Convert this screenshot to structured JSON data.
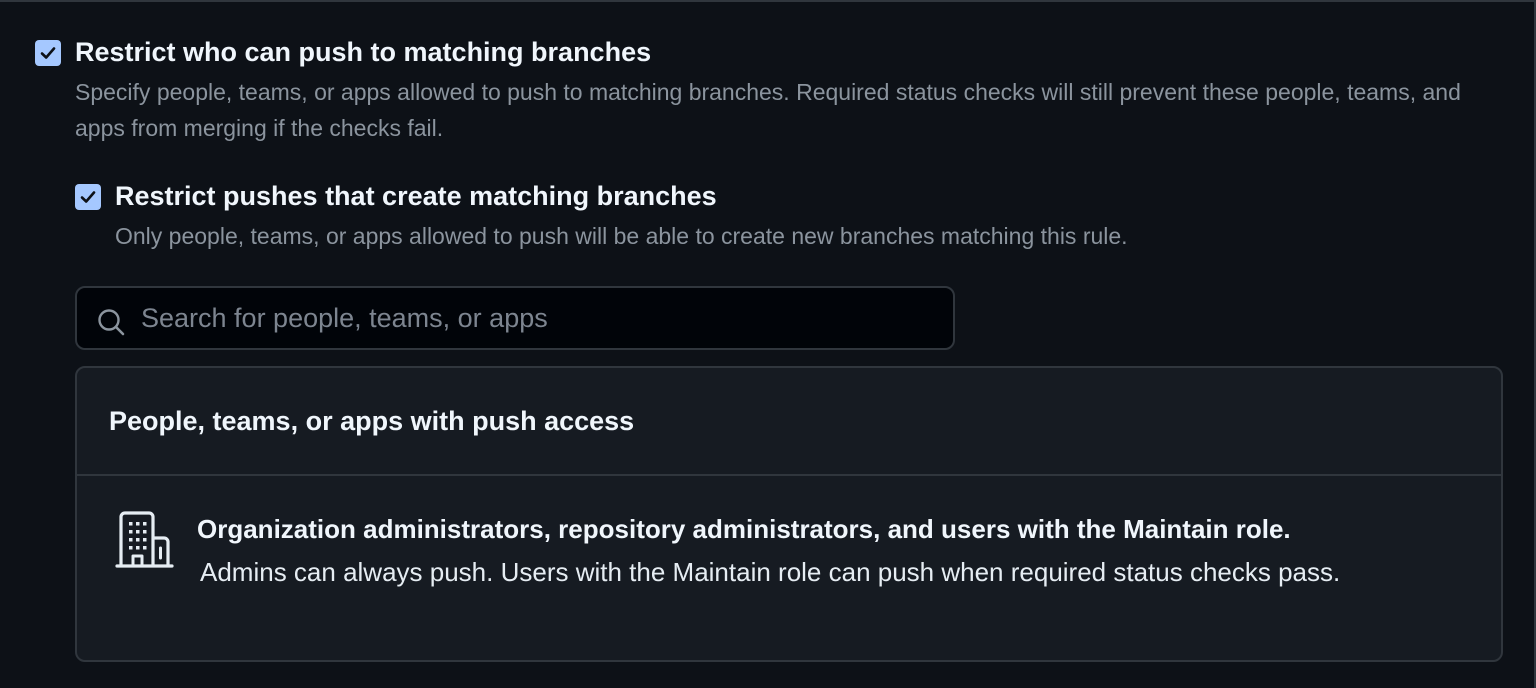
{
  "restrict_push": {
    "checked": true,
    "title": "Restrict who can push to matching branches",
    "description": "Specify people, teams, or apps allowed to push to matching branches. Required status checks will still prevent these people, teams, and apps from merging if the checks fail."
  },
  "restrict_create": {
    "checked": true,
    "title": "Restrict pushes that create matching branches",
    "description": "Only people, teams, or apps allowed to push will be able to create new branches matching this rule."
  },
  "search": {
    "icon": "search-icon",
    "placeholder": "Search for people, teams, or apps",
    "value": ""
  },
  "push_access": {
    "title": "People, teams, or apps with push access",
    "items": [
      {
        "icon": "organization-icon",
        "title": "Organization administrators, repository administrators, and users with the Maintain role.",
        "description": "Admins can always push. Users with the Maintain role can push when required status checks pass."
      }
    ]
  },
  "colors": {
    "background": "#0d1117",
    "panel": "#161b22",
    "border": "#30363d",
    "checkbox": "#a5c8ff",
    "text_primary": "#f0f6fc",
    "text_muted": "#8b949e"
  }
}
